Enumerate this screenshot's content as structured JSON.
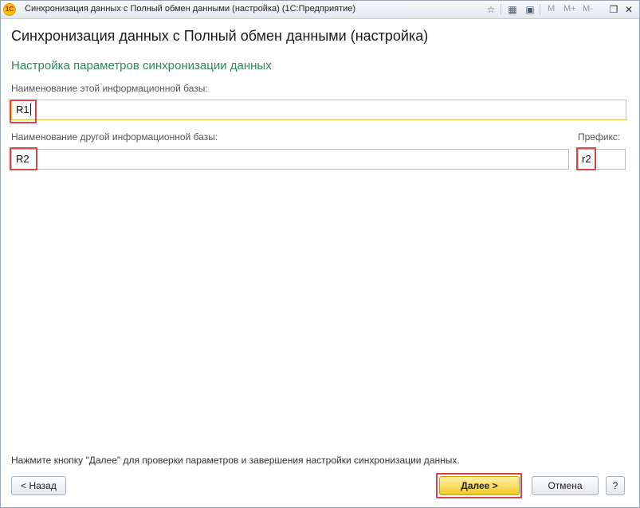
{
  "window": {
    "title": "Синхронизация данных с Полный обмен данными (настройка)  (1С:Предприятие)",
    "logo_text": "1С",
    "toolbar": {
      "m_label": "M",
      "m_plus_label": "M+",
      "m_minus_label": "M-"
    }
  },
  "page": {
    "heading": "Синхронизация данных с Полный обмен данными (настройка)",
    "section_title": "Настройка параметров синхронизации данных"
  },
  "form": {
    "this_base": {
      "label": "Наименование этой информационной базы:",
      "value": "R1"
    },
    "other_base": {
      "label": "Наименование другой информационной базы:",
      "value": "R2"
    },
    "prefix": {
      "label": "Префикс:",
      "value": "r2"
    }
  },
  "footer": {
    "hint": "Нажмите кнопку \"Далее\" для проверки параметров и завершения настройки синхронизации данных.",
    "back_label": "< Назад",
    "next_label": "Далее >",
    "cancel_label": "Отмена",
    "help_label": "?"
  },
  "colors": {
    "section_title": "#2e8b57",
    "highlight": "#d9434a",
    "focus_border": "#f0c040",
    "primary_button": "#f3c925"
  }
}
